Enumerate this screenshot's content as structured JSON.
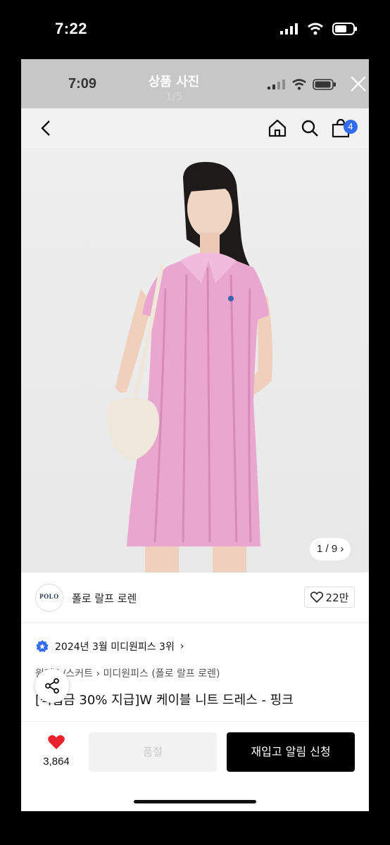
{
  "outer_status": {
    "time": "7:22"
  },
  "viewer": {
    "title": "상품 사진",
    "counter": "1/5"
  },
  "inner_status": {
    "time": "7:09"
  },
  "nav": {
    "cart_badge": "4"
  },
  "image": {
    "counter": "1 / 9 ›"
  },
  "brand": {
    "logo_text": "POLO",
    "name": "폴로 랄프 로렌",
    "likes": "22만"
  },
  "ranking": {
    "text": "2024년 3월 미디원피스 3위",
    "chevron": "›"
  },
  "product": {
    "breadcrumb": "원피스/스커트 › 미디원피스 (폴로 랄프 로렌)",
    "title": "[적립금 30% 지급]W 케이블 니트 드레스 - 핑크"
  },
  "bottom": {
    "heart_count": "3,864",
    "soldout_label": "품절",
    "restock_label": "재입고 알림 신청"
  },
  "colors": {
    "accent_blue": "#2f6cf3",
    "heart_red": "#e8232b",
    "dress_pink": "#e9a6cf"
  }
}
